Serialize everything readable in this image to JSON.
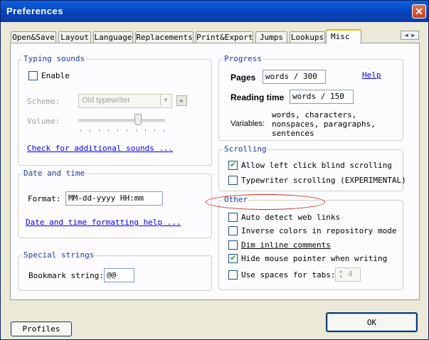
{
  "window": {
    "title": "Preferences",
    "close_glyph": "✕"
  },
  "tabs": [
    {
      "label": "Open&Save"
    },
    {
      "label": "Layout"
    },
    {
      "label": "Language"
    },
    {
      "label": "Replacements"
    },
    {
      "label": "Print&Export"
    },
    {
      "label": "Jumps"
    },
    {
      "label": "Lookups"
    },
    {
      "label": "Misc"
    }
  ],
  "active_tab": "Misc",
  "typing_sounds": {
    "title": "Typing sounds",
    "enable_label": "Enable",
    "enable_checked": false,
    "scheme_label": "Scheme:",
    "scheme_value": "Old typewriter",
    "volume_label": "Volume:",
    "volume_level": 0.75,
    "check_link": "Check for additional sounds ..."
  },
  "date_time": {
    "title": "Date and time",
    "format_label": "Format:",
    "format_value": "MM-dd-yyyy HH:mm",
    "help_link": "Date and time formatting help ..."
  },
  "special_strings": {
    "title": "Special strings",
    "bookmark_label": "Bookmark string:",
    "bookmark_value": "@@"
  },
  "progress": {
    "title": "Progress",
    "pages_label": "Pages",
    "pages_value": "words / 300",
    "help_link": "Help",
    "reading_label": "Reading time",
    "reading_value": "words / 150",
    "variables_label": "Variables:",
    "variables_line1": "words, characters,",
    "variables_line2": "nonspaces, paragraphs,",
    "variables_line3": "sentences"
  },
  "scrolling": {
    "title": "Scrolling",
    "items": [
      {
        "label": "Allow left click blind scrolling",
        "checked": true
      },
      {
        "label": "Typewriter scrolling (EXPERIMENTAL)",
        "checked": false
      }
    ]
  },
  "other": {
    "title": "Other",
    "items": [
      {
        "label": "Auto detect web links",
        "checked": false
      },
      {
        "label": "Inverse colors in repository mode",
        "checked": false
      },
      {
        "label": "Dim inline comments",
        "checked": false
      },
      {
        "label": "Hide mouse pointer when writing",
        "checked": true
      },
      {
        "label": "Use spaces for tabs:",
        "checked": false
      }
    ],
    "tab_spaces_value": "4"
  },
  "buttons": {
    "profiles": "Profiles",
    "ok": "OK"
  }
}
